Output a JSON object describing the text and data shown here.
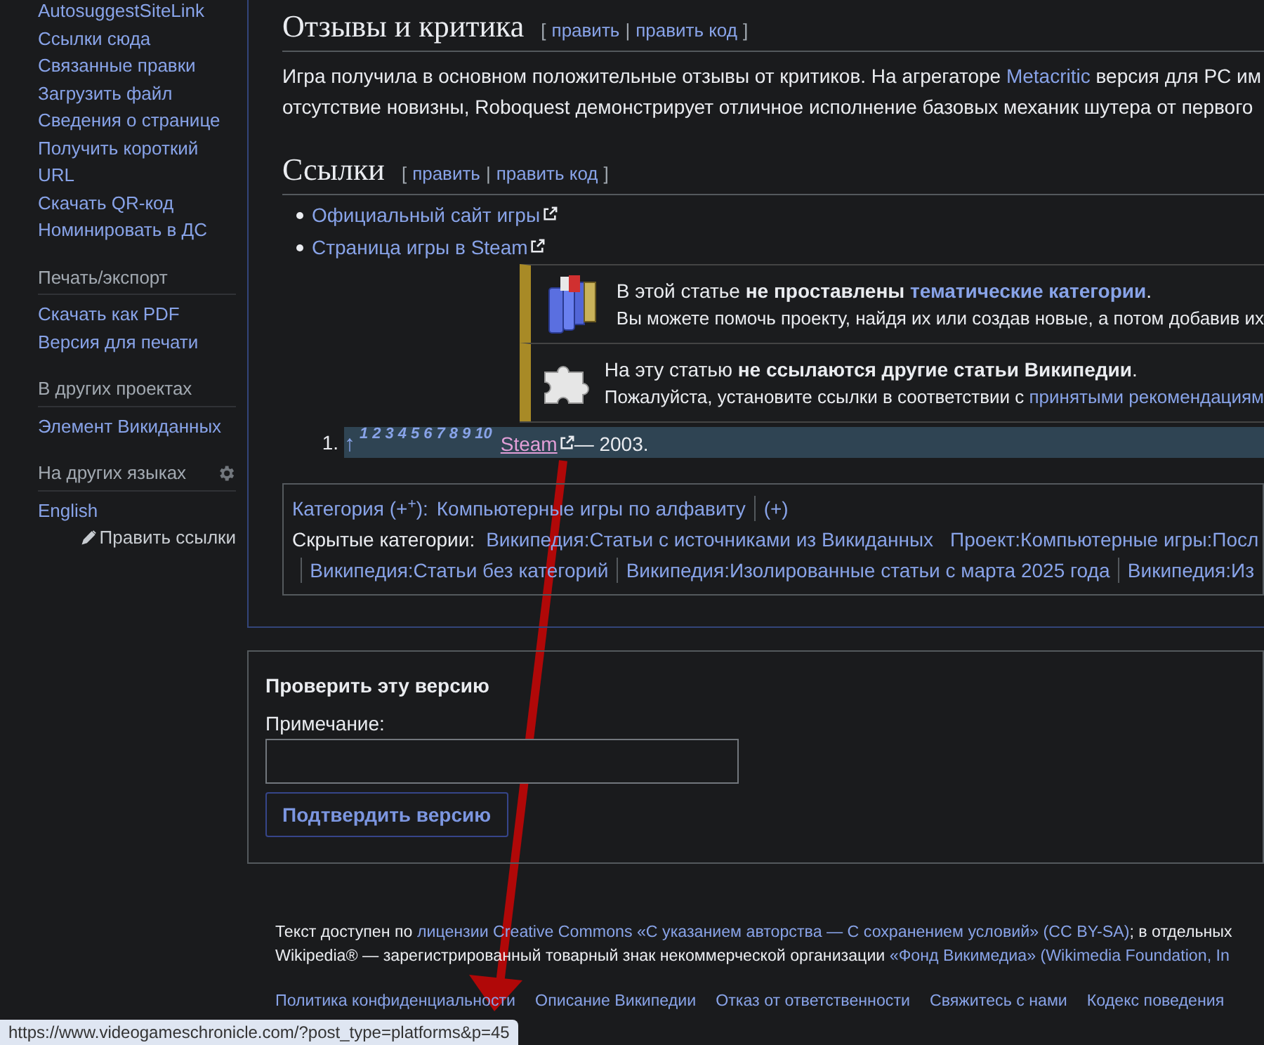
{
  "sidebar": {
    "sections": [
      {
        "kind": "tools",
        "items": [
          "AutosuggestSiteLink",
          "Ссылки сюда",
          "Связанные правки",
          "Загрузить файл",
          "Сведения о странице",
          "Получить короткий URL",
          "Скачать QR-код",
          "Номинировать в ДС"
        ]
      },
      {
        "kind": "tools",
        "heading": "Печать/экспорт",
        "items": [
          "Скачать как PDF",
          "Версия для печати"
        ]
      },
      {
        "kind": "tools",
        "heading": "В других проектах",
        "items": [
          "Элемент Викиданных"
        ]
      },
      {
        "kind": "languages",
        "heading": "На других языках",
        "items": [
          "English"
        ],
        "edit_links": "Править ссылки"
      }
    ]
  },
  "sections": [
    {
      "title": "Отзывы и критика",
      "open": "[",
      "edit": "править",
      "sep": "|",
      "edit_source": "править код",
      "close": "]"
    },
    {
      "title": "Ссылки",
      "open": "[",
      "edit": "править",
      "sep": "|",
      "edit_source": "править код",
      "close": "]"
    }
  ],
  "reviews_paragraph": {
    "before": "Игра получила в основном положительные отзывы от критиков. На агрегаторе ",
    "link": "Metacritic",
    "after": " версия для PC им",
    "line2": "отсутствие новизны, Roboquest демонстрирует отличное исполнение базовых механик шутера от первого"
  },
  "external_links": [
    "Официальный сайт игры",
    "Страница игры в Steam"
  ],
  "notices": [
    {
      "kind": "categories",
      "before": "В этой статье ",
      "bold": "не проставлены",
      "link": "тематические категории",
      "after": ".",
      "line2": "Вы можете помочь проекту, найдя их или создав новые, а потом добавив их"
    },
    {
      "kind": "orphan",
      "before": "На эту статью ",
      "bold": "не ссылаются другие статьи Википедии",
      "after": ".",
      "line2": "Пожалуйста, установите ссылки в соответствии с ",
      "line2_link": "принятыми рекомендациям"
    }
  ],
  "references": [
    {
      "number": "1.",
      "arrow": "↑",
      "backlinks": [
        "1",
        "2",
        "3",
        "4",
        "5",
        "6",
        "7",
        "8",
        "9",
        "10"
      ],
      "link": "Steam",
      "after": " — 2003.",
      "selected": true
    }
  ],
  "categories": {
    "label": "Категория (+$^{+}$):",
    "items": [
      "Компьютерные игры по алфавиту",
      "(+)"
    ],
    "hidden_label": "Скрытые категории:",
    "hidden_items": [
      "Википедия:Статьи с источниками из Викиданных",
      "Проект:Компьютерные игры:Посл",
      "Википедия:Статьи без категорий",
      "Википедия:Изолированные статьи с марта 2025 года",
      "Википедия:Из"
    ]
  },
  "review_form": {
    "title": "Проверить эту версию",
    "note_label": "Примечание:",
    "button": "Подтвердить версию"
  },
  "footer": {
    "line1_before": "Текст доступен по ",
    "line1_link": "лицензии Creative Commons «С указанием авторства — С сохранением условий» (CC BY-SA)",
    "line1_after": "; в отдельных",
    "line2_before": "Wikipedia® — зарегистрированный товарный знак некоммерческой организации ",
    "line2_link": "«Фонд Викимедиа» (Wikimedia Foundation, In",
    "links": [
      "Политика конфиденциальности",
      "Описание Википедии",
      "Отказ от ответственности",
      "Свяжитесь с нами",
      "Кодекс поведения"
    ]
  },
  "status_bar": {
    "url": "https://www.videogameschronicle.com/?post_type=platforms&p=45"
  }
}
